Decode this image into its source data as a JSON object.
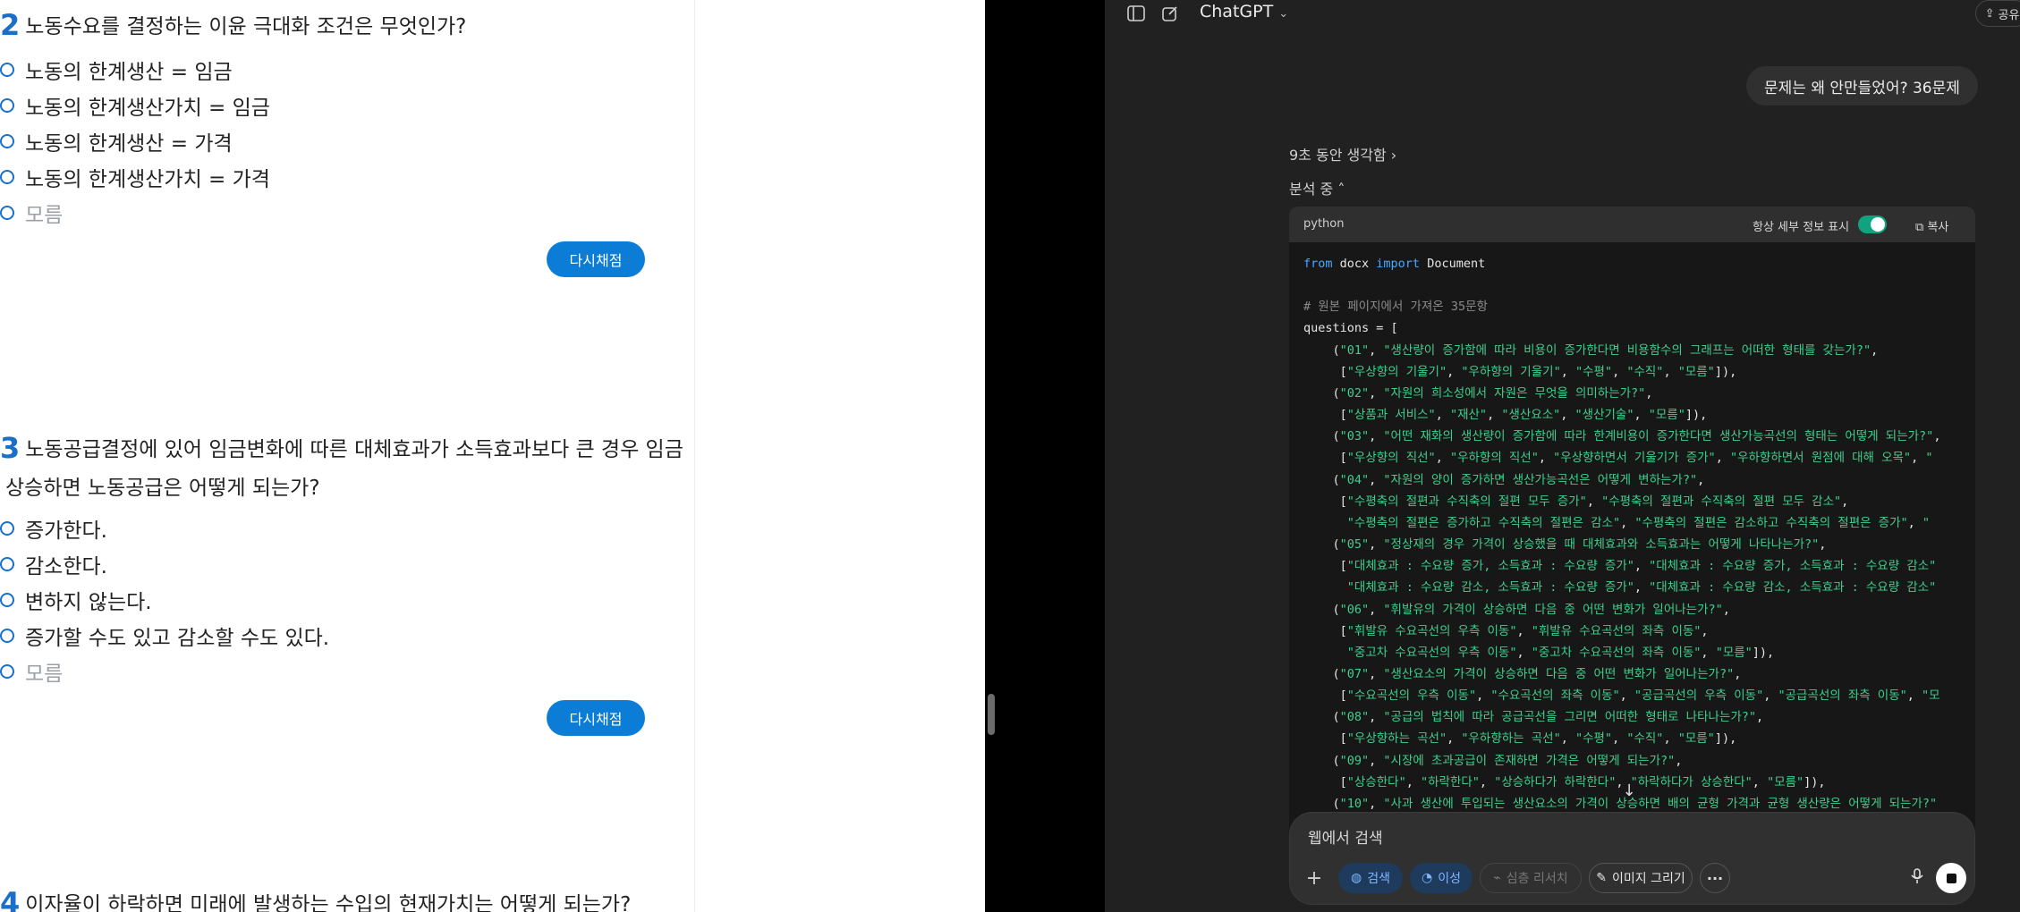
{
  "quiz": {
    "regrade_label": "다시채점",
    "q2": {
      "number": "2",
      "title": "노동수요를 결정하는 이윤 극대화 조건은 무엇인가?",
      "options": [
        "노동의 한계생산 = 임금",
        "노동의 한계생산가치 = 임금",
        "노동의 한계생산 = 가격",
        "노동의 한계생산가치 = 가격",
        "모름"
      ]
    },
    "q3": {
      "number": "3",
      "title_line1": "노동공급결정에 있어 임금변화에 따른 대체효과가 소득효과보다 큰 경우 임금",
      "title_line2": "상승하면 노동공급은 어떻게 되는가?",
      "options": [
        "증가한다.",
        "감소한다.",
        "변하지 않는다.",
        "증가할 수도 있고 감소할 수도 있다.",
        "모름"
      ]
    },
    "q4": {
      "number": "4",
      "title": "이자율이 하락하면 미래에 발생하는 수입의 현재가치는 어떻게 되는가?"
    }
  },
  "chat": {
    "app_title": "ChatGPT",
    "share_label": "공유",
    "user_message": "문제는 왜 안만들었어? 36문제",
    "thought_label": "9초 동안 생각함",
    "analyzing_label": "분석 중",
    "code_lang": "python",
    "toggle_label": "항상 세부 정보 표시",
    "toggle_on": true,
    "copy_label": "복사",
    "code_lines": [
      "from docx import Document",
      "",
      "# 원본 페이지에서 가져온 35문항",
      "questions = [",
      "    (\"01\", \"생산량이 증가함에 따라 비용이 증가한다면 비용함수의 그래프는 어떠한 형태를 갖는가?\",",
      "     [\"우상향의 기울기\", \"우하향의 기울기\", \"수평\", \"수직\", \"모름\"]),",
      "    (\"02\", \"자원의 희소성에서 자원은 무엇을 의미하는가?\",",
      "     [\"상품과 서비스\", \"재산\", \"생산요소\", \"생산기술\", \"모름\"]),",
      "    (\"03\", \"어떤 재화의 생산량이 증가함에 따라 한계비용이 증가한다면 생산가능곡선의 형태는 어떻게 되는가?\",",
      "     [\"우상향의 직선\", \"우하향의 직선\", \"우상향하면서 기울기가 증가\", \"우하향하면서 원점에 대해 오목\", \"",
      "    (\"04\", \"자원의 양이 증가하면 생산가능곡선은 어떻게 변하는가?\",",
      "     [\"수평축의 절편과 수직축의 절편 모두 증가\", \"수평축의 절편과 수직축의 절편 모두 감소\",",
      "      \"수평축의 절편은 증가하고 수직축의 절편은 감소\", \"수평축의 절편은 감소하고 수직축의 절편은 증가\", \"",
      "    (\"05\", \"정상재의 경우 가격이 상승했을 때 대체효과와 소득효과는 어떻게 나타나는가?\",",
      "     [\"대체효과 : 수요량 증가, 소득효과 : 수요량 증가\", \"대체효과 : 수요량 증가, 소득효과 : 수요량 감소\"",
      "      \"대체효과 : 수요량 감소, 소득효과 : 수요량 증가\", \"대체효과 : 수요량 감소, 소득효과 : 수요량 감소\"",
      "    (\"06\", \"휘발유의 가격이 상승하면 다음 중 어떤 변화가 일어나는가?\",",
      "     [\"휘발유 수요곡선의 우측 이동\", \"휘발유 수요곡선의 좌측 이동\",",
      "      \"중고차 수요곡선의 우측 이동\", \"중고차 수요곡선의 좌측 이동\", \"모름\"]),",
      "    (\"07\", \"생산요소의 가격이 상승하면 다음 중 어떤 변화가 일어나는가?\",",
      "     [\"수요곡선의 우측 이동\", \"수요곡선의 좌측 이동\", \"공급곡선의 우측 이동\", \"공급곡선의 좌측 이동\", \"모",
      "    (\"08\", \"공급의 법칙에 따라 공급곡선을 그리면 어떠한 형태로 나타나는가?\",",
      "     [\"우상향하는 곡선\", \"우하향하는 곡선\", \"수평\", \"수직\", \"모름\"]),",
      "    (\"09\", \"시장에 초과공급이 존재하면 가격은 어떻게 되는가?\",",
      "     [\"상승한다\", \"하락한다\", \"상승하다가 하락한다\", \"하락하다가 상승한다\", \"모름\"]),",
      "    (\"10\", \"사과 생산에 투입되는 생산요소의 가격이 상승하면 배의 균형 가격과 균형 생산량은 어떻게 되는가?\""
    ],
    "composer_placeholder": "웹에서 검색",
    "pills": {
      "search": "검색",
      "reason": "이성",
      "deep_research": "심층 리서치",
      "image": "이미지 그리기"
    },
    "colors": {
      "accent_blue": "#0b7dd6",
      "chat_bg": "#212121",
      "toggle_green": "#10a37f"
    }
  }
}
